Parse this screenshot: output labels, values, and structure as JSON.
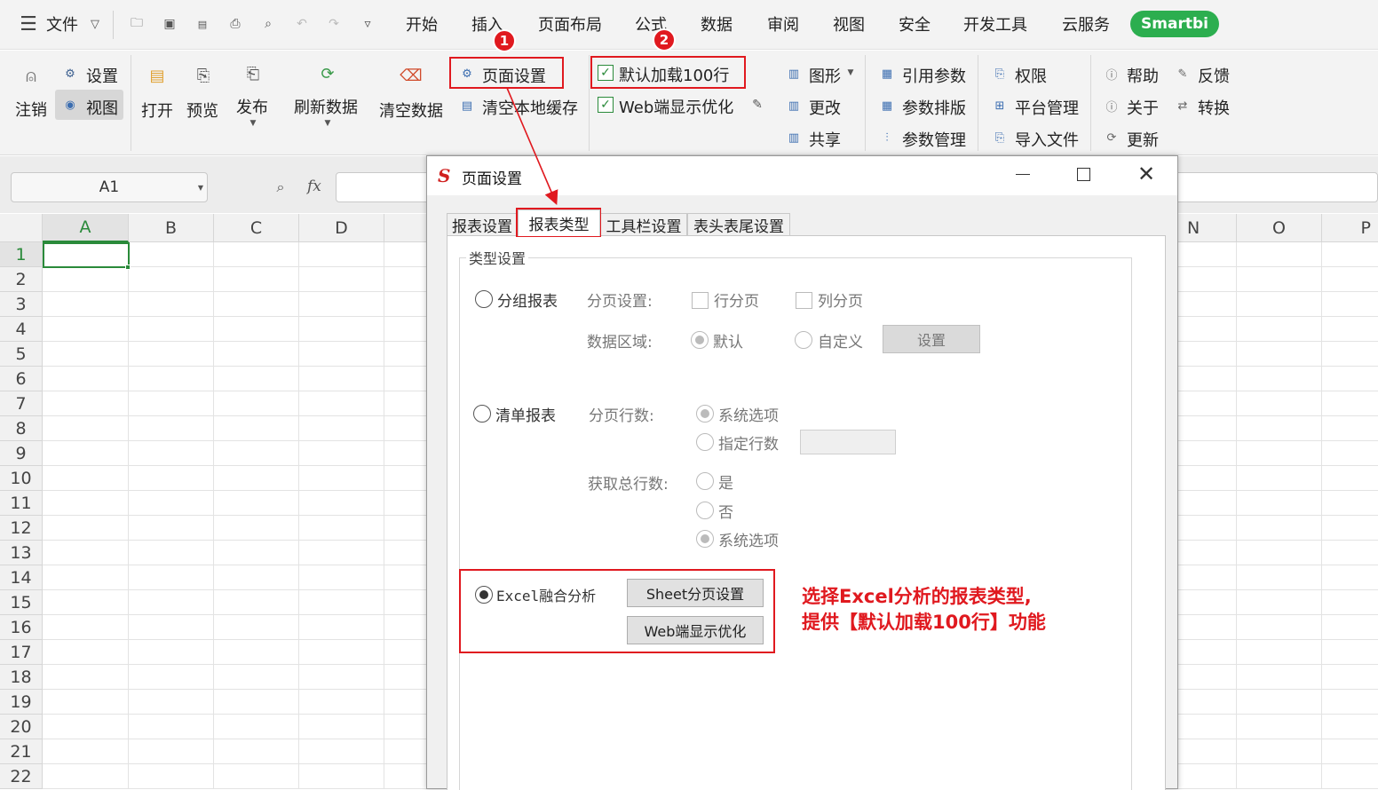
{
  "menubar": {
    "file_label": "文件",
    "tabs": [
      "开始",
      "插入",
      "页面布局",
      "公式",
      "数据",
      "审阅",
      "视图",
      "安全",
      "开发工具",
      "云服务"
    ],
    "smartbi_label": "Smartbi"
  },
  "ribbon": {
    "logout": "注销",
    "settings": "设置",
    "view": "视图",
    "open": "打开",
    "preview": "预览",
    "publish": "发布",
    "refresh": "刷新数据",
    "clear_data": "清空数据",
    "page_setup": "页面设置",
    "clear_cache": "清空本地缓存",
    "default_load": "默认加载100行",
    "web_optimize": "Web端显示优化",
    "chart": "图形",
    "modify": "更改",
    "share": "共享",
    "ref_param": "引用参数",
    "param_layout": "参数排版",
    "param_manage": "参数管理",
    "permission": "权限",
    "platform_manage": "平台管理",
    "import_file": "导入文件",
    "help": "帮助",
    "feedback": "反馈",
    "about": "关于",
    "convert": "转换",
    "update": "更新"
  },
  "formula_bar": {
    "name_box": "A1",
    "fx": "fx"
  },
  "sheet": {
    "columns_left": [
      "A",
      "B",
      "C",
      "D"
    ],
    "columns_right": [
      "N",
      "O",
      "P"
    ],
    "rows": [
      "1",
      "2",
      "3",
      "4",
      "5",
      "6",
      "7",
      "8",
      "9",
      "10",
      "11",
      "12",
      "13",
      "14",
      "15",
      "16",
      "17",
      "18",
      "19",
      "20",
      "21",
      "22"
    ]
  },
  "dialog": {
    "title": "页面设置",
    "tabs": [
      "报表设置",
      "报表类型",
      "工具栏设置",
      "表头表尾设置"
    ],
    "group_title": "类型设置",
    "grouped_report": "分组报表",
    "paging_settings": "分页设置:",
    "row_paging": "行分页",
    "col_paging": "列分页",
    "data_area": "数据区域:",
    "default": "默认",
    "custom": "自定义",
    "set_button": "设置",
    "list_report": "清单报表",
    "paging_rows": "分页行数:",
    "system_option": "系统选项",
    "specified_rows": "指定行数",
    "get_total_rows": "获取总行数:",
    "yes": "是",
    "no": "否",
    "system_option2": "系统选项",
    "excel_analysis": "Excel融合分析",
    "sheet_paging_button": "Sheet分页设置",
    "web_optimize_button": "Web端显示优化"
  },
  "annotations": {
    "badge1": "1",
    "badge2": "2",
    "note_line1": "选择Excel分析的报表类型,",
    "note_line2": "提供【默认加载100行】功能",
    "accent_color": "#e0191f"
  }
}
